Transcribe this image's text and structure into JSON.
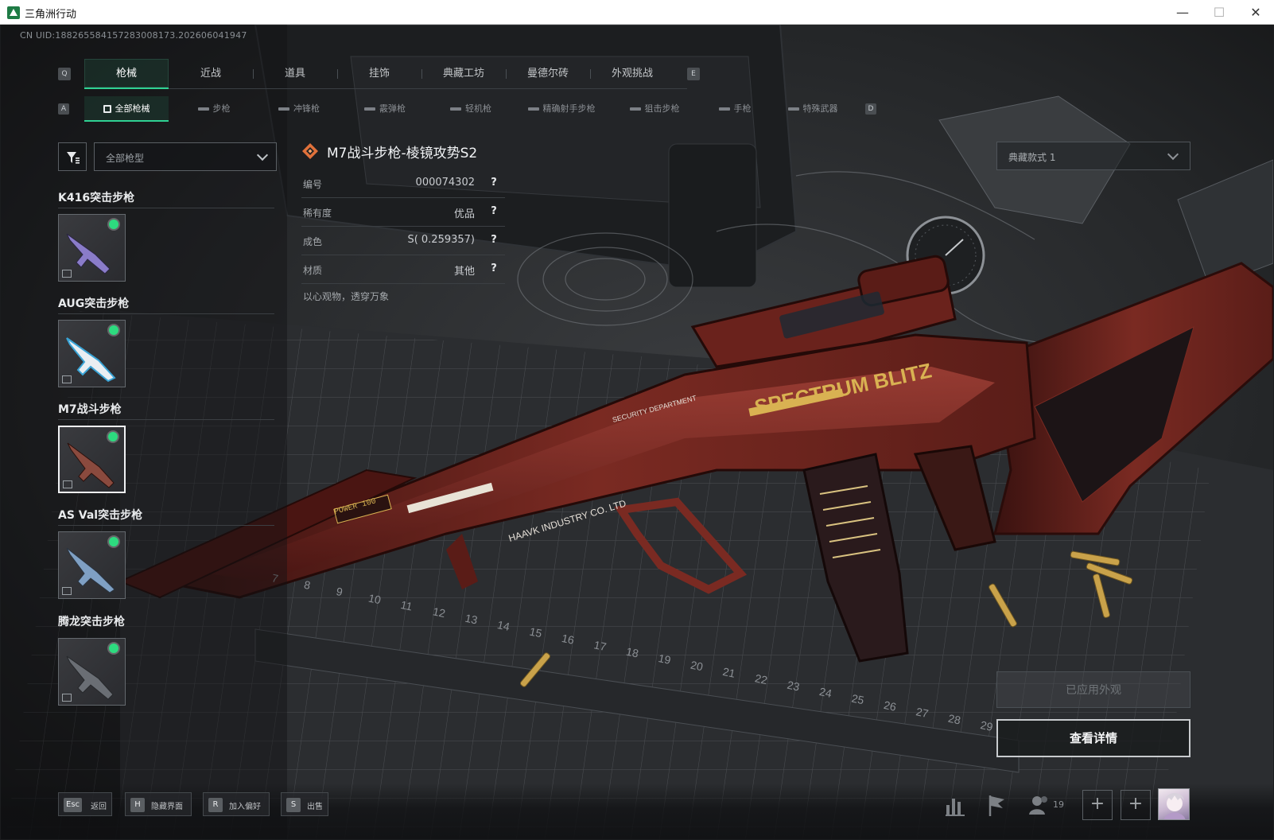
{
  "window": {
    "title": "三角洲行动",
    "min_icon": "minimize-icon",
    "max_icon": "maximize-icon",
    "close_icon": "close-icon",
    "min_glyph": "—",
    "max_glyph": "☐",
    "close_glyph": "✕"
  },
  "uid": "CN UID:18826558415728300817​3.202606041947",
  "tabs": {
    "prev_key": "Q",
    "next_key": "E",
    "items": [
      {
        "label": "枪械",
        "active": true
      },
      {
        "label": "近战",
        "active": false
      },
      {
        "label": "道具",
        "active": false
      },
      {
        "label": "挂饰",
        "active": false
      },
      {
        "label": "典藏工坊",
        "active": false
      },
      {
        "label": "曼德尔砖",
        "active": false
      },
      {
        "label": "外观挑战",
        "active": false
      }
    ]
  },
  "subtabs": {
    "prev_key": "A",
    "next_key": "D",
    "items": [
      {
        "label": "全部枪械",
        "active": true
      },
      {
        "label": "步枪",
        "active": false
      },
      {
        "label": "冲锋枪",
        "active": false
      },
      {
        "label": "霰弹枪",
        "active": false
      },
      {
        "label": "轻机枪",
        "active": false
      },
      {
        "label": "精确射手步枪",
        "active": false
      },
      {
        "label": "狙击步枪",
        "active": false
      },
      {
        "label": "手枪",
        "active": false
      },
      {
        "label": "特殊武器",
        "active": false
      }
    ]
  },
  "filter": {
    "icon": "filter-icon",
    "type_select_value": "全部枪型"
  },
  "weapons": [
    {
      "name": "K416突击步枪",
      "equipped": true,
      "selected": false,
      "accent": "#8a7cc9"
    },
    {
      "name": "AUG突击步枪",
      "equipped": true,
      "selected": false,
      "accent": "#3aa4d6"
    },
    {
      "name": "M7战斗步枪",
      "equipped": true,
      "selected": true,
      "accent": "#8a4a3e"
    },
    {
      "name": "AS Val突击步枪",
      "equipped": true,
      "selected": false,
      "accent": "#7fa0c4"
    },
    {
      "name": "腾龙突击步枪",
      "equipped": true,
      "selected": false,
      "accent": "#6a6e74"
    }
  ],
  "skin": {
    "title": "M7战斗步枪-棱镜攻势S2",
    "rarity_icon": "rarity-diamond-icon",
    "rarity_color": "#e0713a",
    "rows": [
      {
        "label": "编号",
        "value": "000074302",
        "help": "?"
      },
      {
        "label": "稀有度",
        "value": "优品",
        "help": "?"
      },
      {
        "label": "成色",
        "value": "S( 0.259357)",
        "help": "?"
      },
      {
        "label": "材质",
        "value": "其他",
        "help": "?"
      }
    ],
    "description": "以心观物，透穿万象"
  },
  "style_select": {
    "value": "典藏款式 1"
  },
  "buttons": {
    "applied": "已应用外观",
    "detail": "查看详情"
  },
  "hints": [
    {
      "key": "Esc",
      "label": "返回"
    },
    {
      "key": "H",
      "label": "隐藏界面"
    },
    {
      "key": "R",
      "label": "加入偏好"
    },
    {
      "key": "S",
      "label": "出售"
    }
  ],
  "bottom_right": {
    "stats_icon": "bar-chart-icon",
    "flag_icon": "flag-icon",
    "friends_icon": "friends-icon",
    "friends_count": "19",
    "plus_icon": "plus-icon",
    "plus_glyph": "+",
    "avatar": "avatar"
  },
  "gun_text": {
    "brand": "SPECTRUM BLITZ",
    "maker": "HAAVK INDUSTRY CO. LTD",
    "dept": "SECURITY DEPARTMENT",
    "power": "POWER 100"
  },
  "mat_numbers": [
    "7",
    "8",
    "9",
    "10",
    "11",
    "12",
    "13",
    "14",
    "15",
    "16",
    "17",
    "18",
    "19",
    "20",
    "21",
    "22",
    "23",
    "24",
    "25",
    "26",
    "27",
    "28",
    "29"
  ]
}
